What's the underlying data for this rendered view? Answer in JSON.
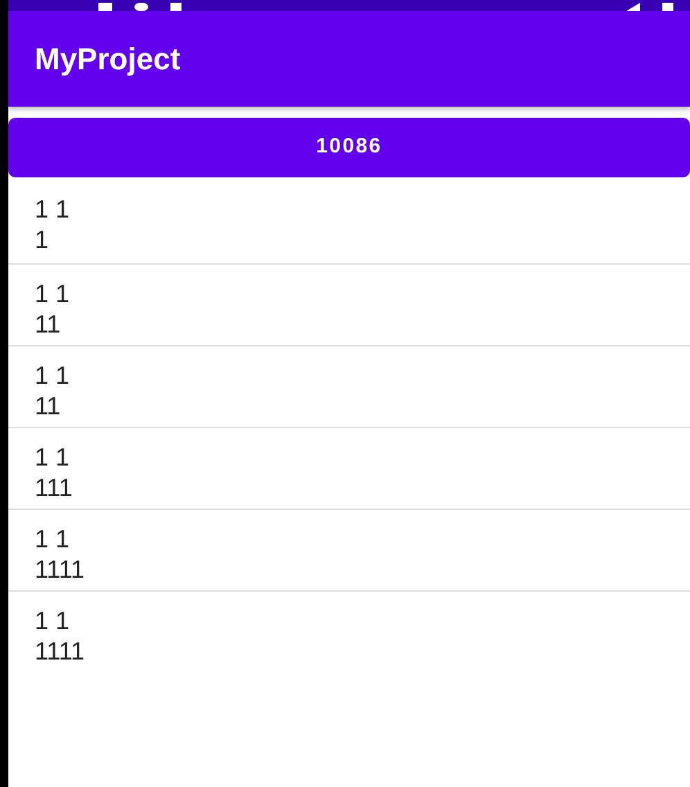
{
  "app_bar": {
    "title": "MyProject"
  },
  "button": {
    "label": "10086"
  },
  "list": [
    {
      "title": "1 1",
      "subtitle": "1"
    },
    {
      "title": "1 1",
      "subtitle": "11"
    },
    {
      "title": "1 1",
      "subtitle": "11"
    },
    {
      "title": "1 1",
      "subtitle": "111"
    },
    {
      "title": "1 1",
      "subtitle": "1111"
    },
    {
      "title": "1 1",
      "subtitle": "1111"
    }
  ]
}
